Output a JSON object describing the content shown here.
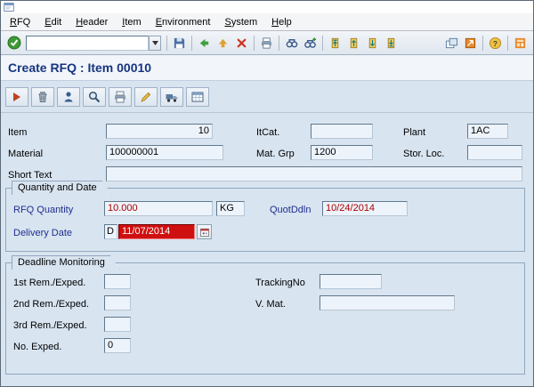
{
  "menu": {
    "items": [
      "RFQ",
      "Edit",
      "Header",
      "Item",
      "Environment",
      "System",
      "Help"
    ]
  },
  "toolbar": {
    "command_field_value": "",
    "icons": [
      "enter",
      "save",
      "back",
      "exit",
      "cancel",
      "print",
      "find",
      "find-next",
      "first-page",
      "page-up",
      "page-down",
      "last-page",
      "new-session",
      "create-shortcut",
      "help",
      "customize-layout"
    ]
  },
  "app_toolbar": {
    "icons": [
      "next-item",
      "delete",
      "address",
      "item-details",
      "print-preview",
      "edit",
      "delivery-schedule",
      "statistics"
    ]
  },
  "header": {
    "title": "Create RFQ : Item 00010"
  },
  "form": {
    "item": {
      "label": "Item",
      "value": "10"
    },
    "itcat": {
      "label": "ItCat.",
      "value": ""
    },
    "plant": {
      "label": "Plant",
      "value": "1AC"
    },
    "material": {
      "label": "Material",
      "value": "100000001"
    },
    "mat_grp": {
      "label": "Mat. Grp",
      "value": "1200"
    },
    "stor_loc": {
      "label": "Stor. Loc.",
      "value": ""
    },
    "short_text": {
      "label": "Short Text",
      "value": ""
    }
  },
  "quantity_date": {
    "title": "Quantity and Date",
    "rfq_quantity": {
      "label": "RFQ Quantity",
      "value": "10.000",
      "unit": "KG"
    },
    "quot_deadline": {
      "label": "QuotDdln",
      "value": "10/24/2014"
    },
    "delivery_date": {
      "label": "Delivery Date",
      "period": "D",
      "value": "11/07/2014"
    }
  },
  "deadline_monitoring": {
    "title": "Deadline Monitoring",
    "rem1": {
      "label": "1st Rem./Exped.",
      "value": ""
    },
    "rem2": {
      "label": "2nd Rem./Exped.",
      "value": ""
    },
    "rem3": {
      "label": "3rd Rem./Exped.",
      "value": ""
    },
    "no_exped": {
      "label": "No. Exped.",
      "value": "0"
    },
    "tracking_no": {
      "label": "TrackingNo",
      "value": ""
    },
    "v_mat": {
      "label": "V. Mat.",
      "value": ""
    }
  },
  "colors": {
    "page_bg": "#d8e4f0",
    "title_text": "#17357f",
    "value_red": "#aa0000",
    "error_field_bg": "#cf1010",
    "group_label_blue": "#1f2f8f"
  }
}
